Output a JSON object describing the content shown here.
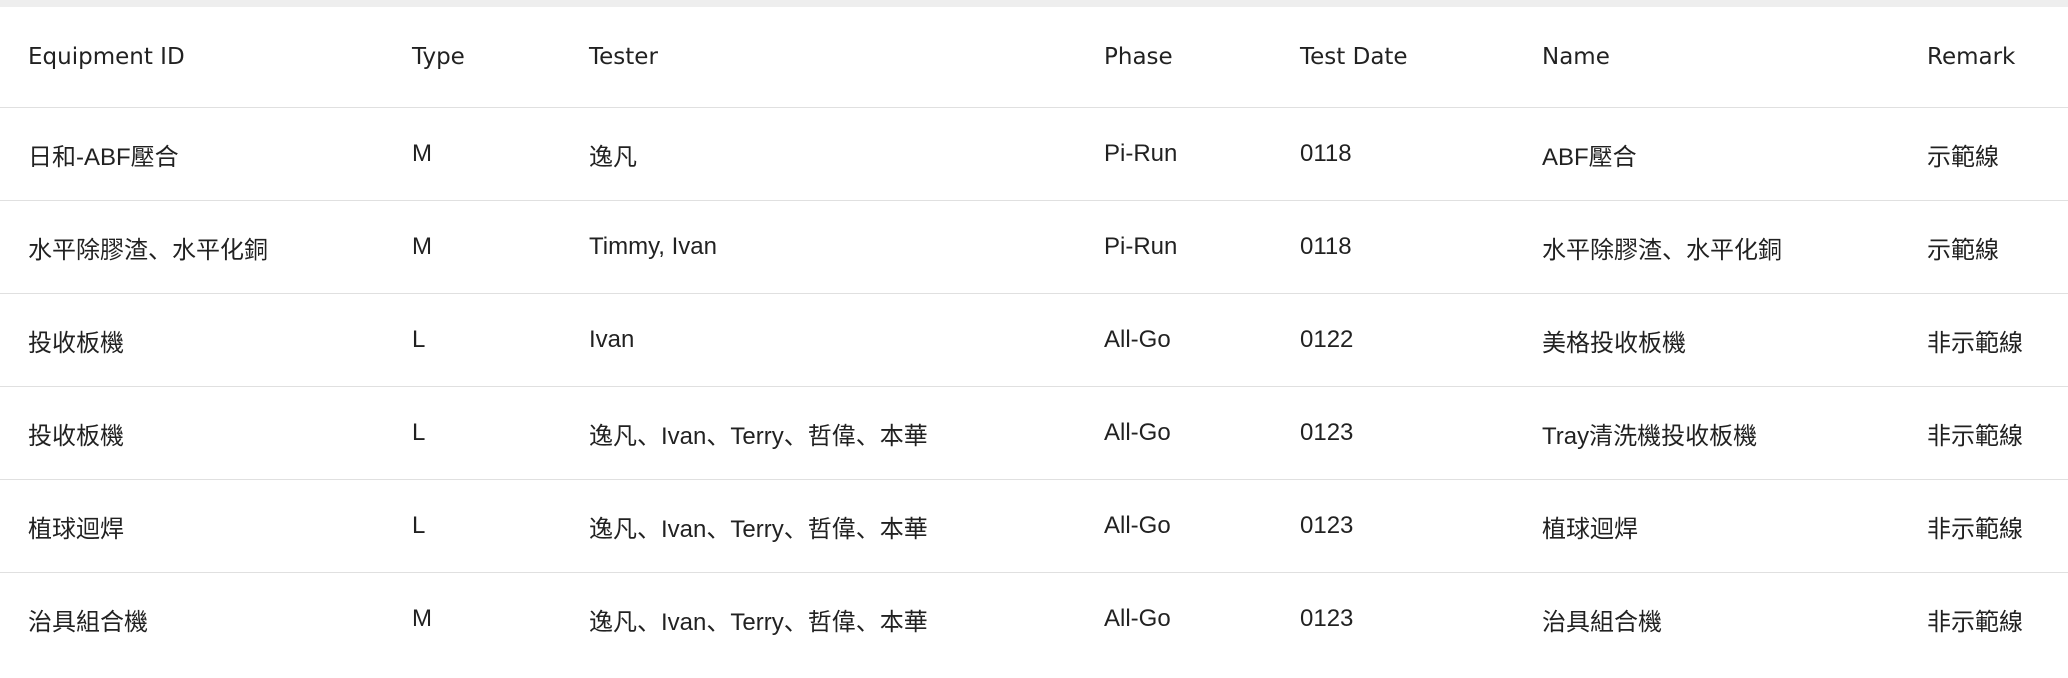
{
  "table": {
    "columns": [
      "Equipment ID",
      "Type",
      "Tester",
      "Phase",
      "Test Date",
      "Name",
      "Remark"
    ],
    "rows": [
      [
        "日和-ABF壓合",
        "M",
        "逸凡",
        "Pi-Run",
        "0118",
        "ABF壓合",
        "示範線"
      ],
      [
        "水平除膠渣、水平化銅",
        "M",
        "Timmy, Ivan",
        "Pi-Run",
        "0118",
        "水平除膠渣、水平化銅",
        "示範線"
      ],
      [
        "投收板機",
        "L",
        "Ivan",
        "All-Go",
        "0122",
        "美格投收板機",
        "非示範線"
      ],
      [
        "投收板機",
        "L",
        "逸凡、Ivan、Terry、哲偉、本華",
        "All-Go",
        "0123",
        "Tray清洗機投收板機",
        "非示範線"
      ],
      [
        "植球迴焊",
        "L",
        "逸凡、Ivan、Terry、哲偉、本華",
        "All-Go",
        "0123",
        "植球迴焊",
        "非示範線"
      ],
      [
        "治具組合機",
        "M",
        "逸凡、Ivan、Terry、哲偉、本華",
        "All-Go",
        "0123",
        "治具組合機",
        "非示範線"
      ]
    ]
  }
}
